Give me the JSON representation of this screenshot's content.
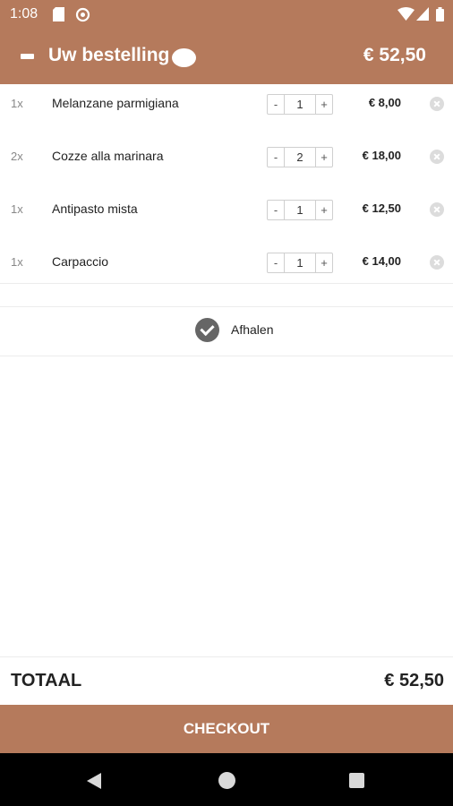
{
  "status_bar": {
    "time": "1:08",
    "icons": [
      "sd-card-icon",
      "sync-icon",
      "wifi-icon",
      "signal-icon",
      "battery-icon"
    ]
  },
  "header": {
    "title": "Uw bestelling",
    "total": "€ 52,50",
    "background_color": "#b57a5c"
  },
  "order_items": [
    {
      "qty_text": "1x",
      "name": "Melanzane parmigiana",
      "quantity": "1",
      "price": "€ 8,00"
    },
    {
      "qty_text": "2x",
      "name": "Cozze alla marinara",
      "quantity": "2",
      "price": "€ 18,00"
    },
    {
      "qty_text": "1x",
      "name": "Antipasto mista",
      "quantity": "1",
      "price": "€ 12,50"
    },
    {
      "qty_text": "1x",
      "name": "Carpaccio",
      "quantity": "1",
      "price": "€ 14,00"
    }
  ],
  "stepper": {
    "minus": "-",
    "plus": "+"
  },
  "pickup": {
    "label": "Afhalen",
    "checked": true
  },
  "total": {
    "label": "TOTAAL",
    "value": "€ 52,50"
  },
  "checkout": {
    "label": "CHECKOUT"
  },
  "nav": {
    "icons": [
      "back-icon",
      "home-icon",
      "recent-apps-icon"
    ]
  }
}
